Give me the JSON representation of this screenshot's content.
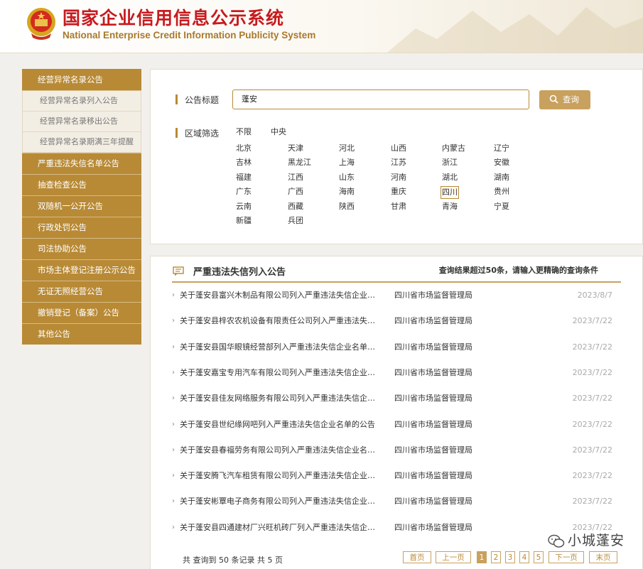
{
  "header": {
    "title": "国家企业信用信息公示系统",
    "subtitle": "National Enterprise Credit Information Publicity System"
  },
  "sidebar": {
    "head": "经营异常名录公告",
    "sub_items": [
      "经营异常名录列入公告",
      "经营异常名录移出公告",
      "经营异常名录期满三年提醒"
    ],
    "items": [
      "严重违法失信名单公告",
      "抽查检查公告",
      "双随机一公开公告",
      "行政处罚公告",
      "司法协助公告",
      "市场主体登记注册公示公告",
      "无证无照经营公告",
      "撤销登记（备案）公告",
      "其他公告"
    ]
  },
  "filter": {
    "title_label": "公告标题",
    "search_value": "蓬安",
    "search_button": "查询",
    "region_label": "区域筛选",
    "top_options": [
      "不限",
      "中央"
    ],
    "selected_region": "四川",
    "regions": [
      [
        "北京",
        "天津",
        "河北",
        "山西",
        "内蒙古",
        "辽宁"
      ],
      [
        "吉林",
        "黑龙江",
        "上海",
        "江苏",
        "浙江",
        "安徽"
      ],
      [
        "福建",
        "江西",
        "山东",
        "河南",
        "湖北",
        "湖南"
      ],
      [
        "广东",
        "广西",
        "海南",
        "重庆",
        "四川",
        "贵州"
      ],
      [
        "云南",
        "西藏",
        "陕西",
        "甘肃",
        "青海",
        "宁夏"
      ],
      [
        "新疆",
        "兵团"
      ]
    ]
  },
  "results": {
    "title": "严重违法失信列入公告",
    "note": "查询结果超过50条，请输入更精确的查询条件",
    "rows": [
      {
        "title": "关于蓬安县富兴木制品有限公司列入严重违法失信企业名单的公告",
        "org": "四川省市场监督管理局",
        "date": "2023/8/7"
      },
      {
        "title": "关于蓬安县梓农农机设备有限责任公司列入严重违法失信企业名单的公告",
        "org": "四川省市场监督管理局",
        "date": "2023/7/22"
      },
      {
        "title": "关于蓬安县国华眼镜经营部列入严重违法失信企业名单的公告",
        "org": "四川省市场监督管理局",
        "date": "2023/7/22"
      },
      {
        "title": "关于蓬安嘉宝专用汽车有限公司列入严重违法失信企业名单的公告",
        "org": "四川省市场监督管理局",
        "date": "2023/7/22"
      },
      {
        "title": "关于蓬安县佳友网络服务有限公司列入严重违法失信企业名单的公告",
        "org": "四川省市场监督管理局",
        "date": "2023/7/22"
      },
      {
        "title": "关于蓬安县世纪缘网吧列入严重违法失信企业名单的公告",
        "org": "四川省市场监督管理局",
        "date": "2023/7/22"
      },
      {
        "title": "关于蓬安县春福劳务有限公司列入严重违法失信企业名单的公告",
        "org": "四川省市场监督管理局",
        "date": "2023/7/22"
      },
      {
        "title": "关于蓬安腾飞汽车租赁有限公司列入严重违法失信企业名单的公告",
        "org": "四川省市场监督管理局",
        "date": "2023/7/22"
      },
      {
        "title": "关于蓬安彬覃电子商务有限公司列入严重违法失信企业名单的公告",
        "org": "四川省市场监督管理局",
        "date": "2023/7/22"
      },
      {
        "title": "关于蓬安县四通建材厂兴旺机砖厂列入严重违法失信企业名单的公告",
        "org": "四川省市场监督管理局",
        "date": "2023/7/22"
      }
    ]
  },
  "pager": {
    "summary": "共 查询到 50 条记录 共 5 页",
    "first": "首页",
    "prev": "上一页",
    "pages": [
      "1",
      "2",
      "3",
      "4",
      "5"
    ],
    "current": "1",
    "next": "下一页",
    "last": "末页"
  },
  "watermark": "小城蓬安",
  "colors": {
    "accent": "#b88a36",
    "title_red": "#c61b1f",
    "button": "#c9a15e"
  }
}
